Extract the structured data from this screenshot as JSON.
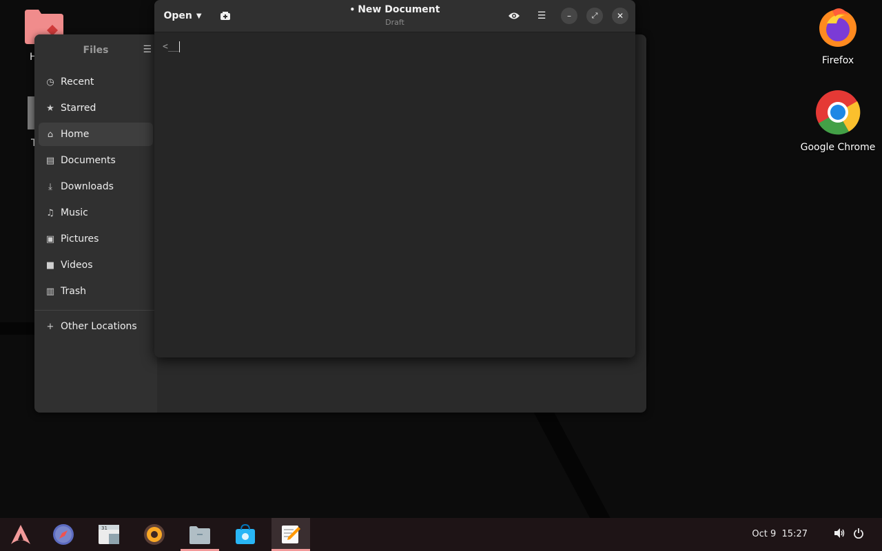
{
  "desktop": {
    "icons": [
      {
        "name": "Firefox"
      },
      {
        "name": "Google Chrome"
      }
    ],
    "partial_labels": [
      "H",
      "T"
    ]
  },
  "files": {
    "title": "Files",
    "items": [
      {
        "label": "Recent",
        "icon": "clock-icon"
      },
      {
        "label": "Starred",
        "icon": "star-icon"
      },
      {
        "label": "Home",
        "icon": "home-icon",
        "active": true
      },
      {
        "label": "Documents",
        "icon": "document-icon"
      },
      {
        "label": "Downloads",
        "icon": "download-icon"
      },
      {
        "label": "Music",
        "icon": "music-icon"
      },
      {
        "label": "Pictures",
        "icon": "picture-icon"
      },
      {
        "label": "Videos",
        "icon": "video-icon"
      },
      {
        "label": "Trash",
        "icon": "trash-icon"
      }
    ],
    "other_locations": "Other Locations"
  },
  "editor": {
    "open_label": "Open",
    "title": "New Document",
    "modified_marker": "•",
    "subtitle": "Draft",
    "content": "<__"
  },
  "taskbar": {
    "apps": [
      "app-menu",
      "web-browser",
      "calendar",
      "rhythmbox",
      "files",
      "software",
      "text-editor"
    ],
    "date": "Oct 9",
    "time": "15:27"
  },
  "colors": {
    "accent": "#f29a9a",
    "panel": "#1e1416",
    "window": "#262626"
  }
}
